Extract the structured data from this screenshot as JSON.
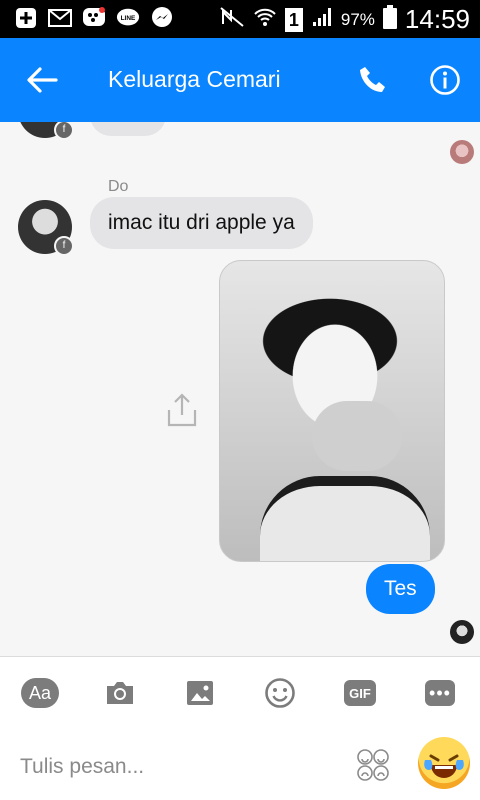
{
  "status_bar": {
    "battery": "97%",
    "sim": "1",
    "time": "14:59"
  },
  "header": {
    "title": "Keluarga Cemari",
    "accent": "#0a84ff"
  },
  "messages": [
    {
      "type": "incoming",
      "sender": "Do",
      "text": "imac itu dri apple ya"
    },
    {
      "type": "outgoing_image"
    },
    {
      "type": "outgoing",
      "text": "Tes"
    }
  ],
  "toolbar": {
    "aa_label": "Aa",
    "gif_label": "GIF",
    "more_label": "•••"
  },
  "composer": {
    "placeholder": "Tulis pesan..."
  }
}
